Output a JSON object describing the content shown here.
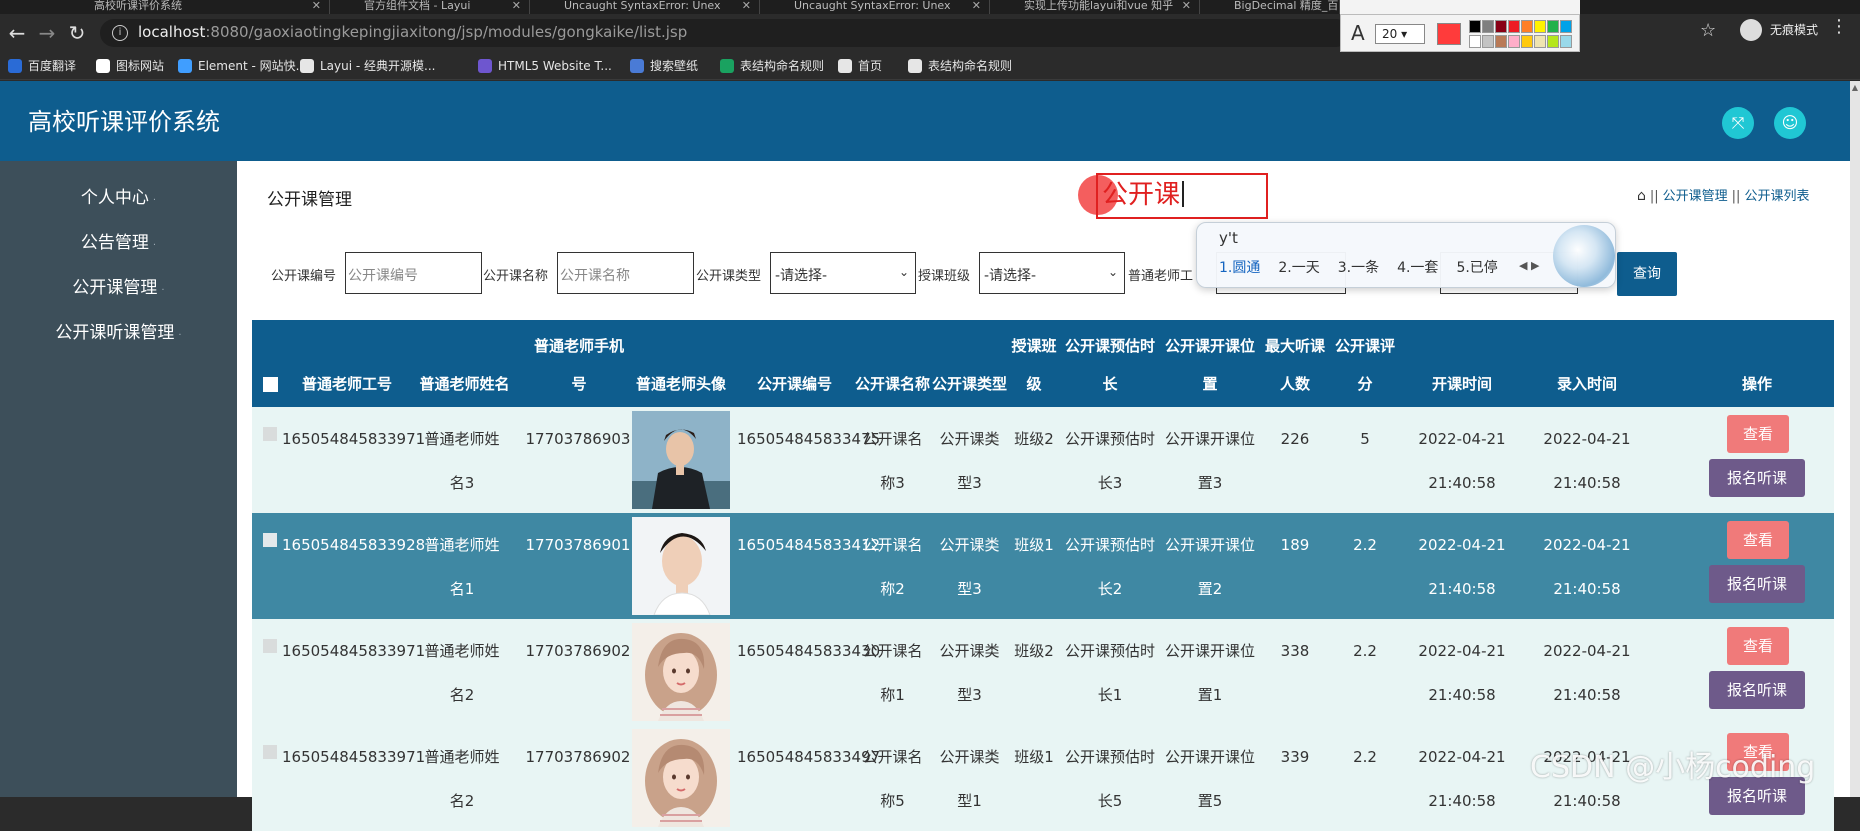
{
  "browser": {
    "tabs": [
      {
        "label": "高校听课评价系统"
      },
      {
        "label": "官方组件文档 - Layui"
      },
      {
        "label": "Uncaught SyntaxError: Unex"
      },
      {
        "label": "Uncaught SyntaxError: Unex"
      },
      {
        "label": "实现上传功能layui和vue 知乎"
      },
      {
        "label": "BigDecimal 精度_百"
      }
    ],
    "url_host": "localhost",
    "url_path": ":8080/gaoxiaotingkepingjiaxitong/jsp/modules/gongkaike/list.jsp",
    "incognito_label": "无痕模式",
    "bookmarks": [
      {
        "label": "百度翻译",
        "color": "#2a6bd6"
      },
      {
        "label": "图标网站",
        "color": "#ffffff"
      },
      {
        "label": "Element - 网站快...",
        "color": "#409eff"
      },
      {
        "label": "Layui - 经典开源模...",
        "color": "#e6e6e6"
      },
      {
        "label": "HTML5 Website T...",
        "color": "#6e56cf"
      },
      {
        "label": "搜索壁纸",
        "color": "#4a7bd6"
      },
      {
        "label": "表结构命名规则",
        "color": "#1aa260"
      },
      {
        "label": "首页",
        "color": "#e6e6e6"
      },
      {
        "label": "表结构命名规则",
        "color": "#e6e6e6"
      }
    ]
  },
  "annotation_toolbar": {
    "font_size": "20",
    "current_color": "#ff3b3b",
    "palette": [
      "#000000",
      "#7f7f7f",
      "#880015",
      "#ed1c24",
      "#ff7f27",
      "#fff200",
      "#22b14c",
      "#00a2e8",
      "#ffffff",
      "#c3c3c3",
      "#b97a57",
      "#ffaec9",
      "#ffc90e",
      "#efe4b0",
      "#b5e61d",
      "#99d9ea"
    ]
  },
  "app": {
    "title": "高校听课评价系统",
    "header_icons": [
      "fullscreen-icon",
      "user-icon"
    ],
    "sidebar": [
      {
        "label": "个人中心"
      },
      {
        "label": "公告管理"
      },
      {
        "label": "公开课管理"
      },
      {
        "label": "公开课听课管理"
      }
    ],
    "page_heading": "公开课管理",
    "breadcrumb": [
      "公开课管理",
      "公开课列表"
    ],
    "annotation_text": "公开课"
  },
  "search": {
    "fields": [
      {
        "label": "公开课编号",
        "placeholder": "公开课编号"
      },
      {
        "label": "公开课名称",
        "placeholder": "公开课名称"
      },
      {
        "label": "公开课类型",
        "select": "-请选择-"
      },
      {
        "label": "授课班级",
        "select": "-请选择-"
      },
      {
        "label": "普通老师工"
      }
    ],
    "query_label": "查询"
  },
  "ime": {
    "pinyin": "y't",
    "candidates": [
      "1.圆通",
      "2.一天",
      "3.一条",
      "4.一套",
      "5.已停"
    ]
  },
  "table": {
    "headers": {
      "teacher_no": "普通老师工号",
      "teacher_name": "普通老师姓名",
      "phone_top": "普通老师手机",
      "phone_bottom": "号",
      "avatar": "普通老师头像",
      "course_no": "公开课编号",
      "course_name": "公开课名称",
      "course_type": "公开课类型",
      "class_top": "授课班",
      "class_bottom": "级",
      "duration_top": "公开课预估时",
      "duration_bottom": "长",
      "location_top": "公开课开课位",
      "location_bottom": "置",
      "max_top": "最大听课",
      "max_bottom": "人数",
      "score_top": "公开课评",
      "score_bottom": "分",
      "start_time": "开课时间",
      "entry_time": "录入时间",
      "actions": "操作"
    },
    "rows": [
      {
        "teacher_no": "165054845833971",
        "name_a": "普通老师姓",
        "name_b": "名3",
        "phone": "17703786903",
        "course_no": "165054845833475",
        "cname_a": "公开课名",
        "cname_b": "称3",
        "ctype_a": "公开课类",
        "ctype_b": "型3",
        "class": "班级2",
        "dur_a": "公开课预估时",
        "dur_b": "长3",
        "loc_a": "公开课开课位",
        "loc_b": "置3",
        "max": "226",
        "score": "5",
        "start_date": "2022-04-21",
        "start_time": "21:40:58",
        "entry_date": "2022-04-21",
        "entry_time": "21:40:58",
        "avatar": "male-dark"
      },
      {
        "teacher_no": "165054845833928",
        "name_a": "普通老师姓",
        "name_b": "名1",
        "phone": "17703786901",
        "course_no": "165054845833412",
        "cname_a": "公开课名",
        "cname_b": "称2",
        "ctype_a": "公开课类",
        "ctype_b": "型3",
        "class": "班级1",
        "dur_a": "公开课预估时",
        "dur_b": "长2",
        "loc_a": "公开课开课位",
        "loc_b": "置2",
        "max": "189",
        "score": "2.2",
        "start_date": "2022-04-21",
        "start_time": "21:40:58",
        "entry_date": "2022-04-21",
        "entry_time": "21:40:58",
        "avatar": "male-light"
      },
      {
        "teacher_no": "165054845833971",
        "name_a": "普通老师姓",
        "name_b": "名2",
        "phone": "17703786902",
        "course_no": "165054845833430",
        "cname_a": "公开课名",
        "cname_b": "称1",
        "ctype_a": "公开课类",
        "ctype_b": "型3",
        "class": "班级2",
        "dur_a": "公开课预估时",
        "dur_b": "长1",
        "loc_a": "公开课开课位",
        "loc_b": "置1",
        "max": "338",
        "score": "2.2",
        "start_date": "2022-04-21",
        "start_time": "21:40:58",
        "entry_date": "2022-04-21",
        "entry_time": "21:40:58",
        "avatar": "female"
      },
      {
        "teacher_no": "165054845833971",
        "name_a": "普通老师姓",
        "name_b": "名2",
        "phone": "17703786902",
        "course_no": "165054845833497",
        "cname_a": "公开课名",
        "cname_b": "称5",
        "ctype_a": "公开课类",
        "ctype_b": "型1",
        "class": "班级1",
        "dur_a": "公开课预估时",
        "dur_b": "长5",
        "loc_a": "公开课开课位",
        "loc_b": "置5",
        "max": "339",
        "score": "2.2",
        "start_date": "2022-04-21",
        "start_time": "21:40:58",
        "entry_date": "2022-04-21",
        "entry_time": "21:40:58",
        "avatar": "female"
      }
    ],
    "view_label": "查看",
    "enroll_label": "报名听课"
  },
  "watermark": "CSDN @小杨coding"
}
